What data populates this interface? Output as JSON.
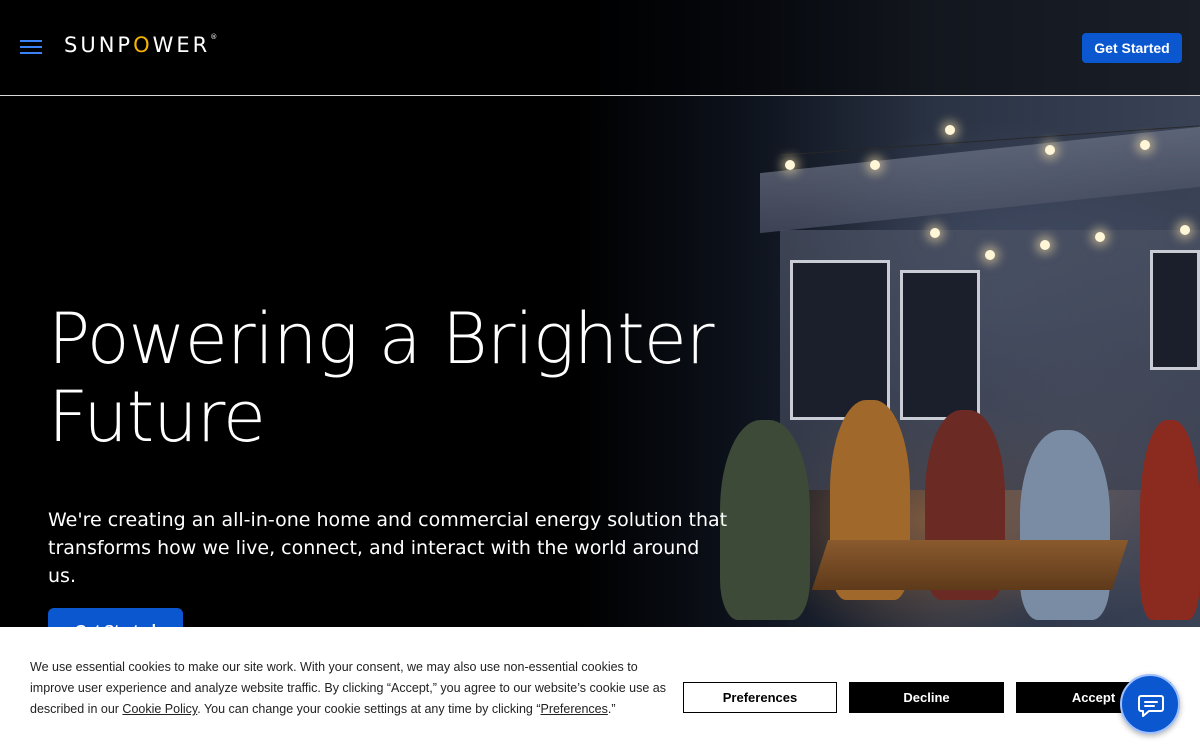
{
  "header": {
    "brand": {
      "pre": "SUNP",
      "o": "O",
      "post": "WER",
      "mark": "®"
    },
    "cta_label": "Get Started"
  },
  "hero": {
    "title_line1": "Powering a Brighter",
    "title_line2": "Future",
    "subtitle_line1": "We're creating an all-in-one home and commercial energy solution that",
    "subtitle_line2": "transforms how we live, connect, and interact with the world around us.",
    "cta_label": "Get Started"
  },
  "cookie_banner": {
    "text_part1": "We use essential cookies to make our site work. With your consent, we may also use non-essential cookies to improve user experience and analyze website traffic. By clicking “Accept,” you agree to our website’s cookie use as described in our ",
    "cookie_policy_link": "Cookie Policy",
    "text_part2": ". You can change your cookie settings at any time by clicking “",
    "preferences_link": "Preferences",
    "text_part3": ".”",
    "preferences_label": "Preferences",
    "decline_label": "Decline",
    "accept_label": "Accept"
  },
  "icons": {
    "menu": "hamburger-menu-icon",
    "chat": "chat-bubble-icon"
  },
  "colors": {
    "brand_blue": "#0b57d0",
    "logo_accent": "#f6b400",
    "menu_icon": "#3b82f6"
  }
}
